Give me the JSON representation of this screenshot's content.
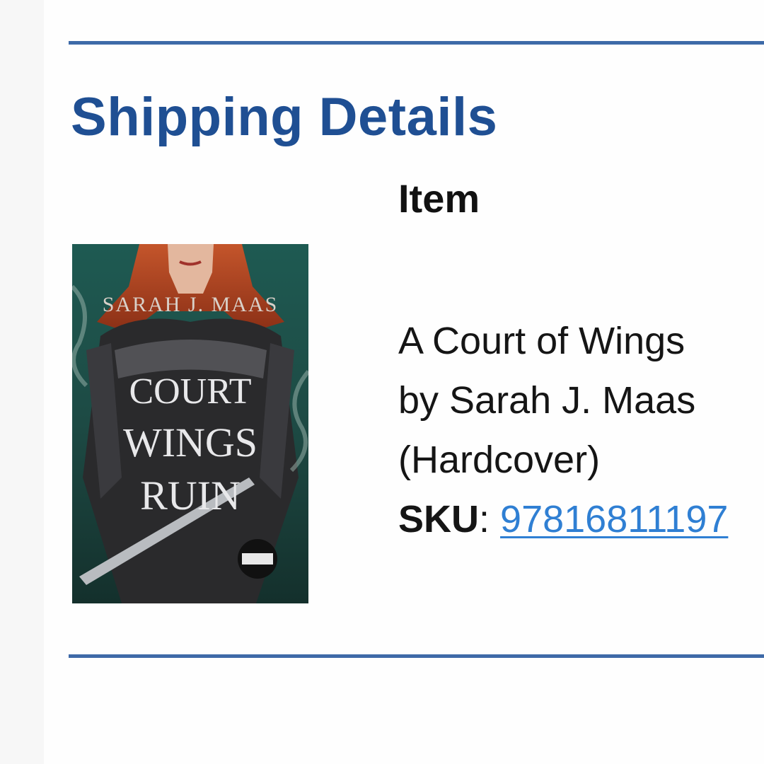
{
  "section": {
    "title": "Shipping Details"
  },
  "table": {
    "item_header": "Item"
  },
  "item": {
    "title_line": "A Court of Wings",
    "author_line": "by Sarah J. Maas",
    "format_line": "(Hardcover)",
    "sku_label": "SKU",
    "sku_separator": ":",
    "sku_value": "97816811197",
    "cover": {
      "author_text": "SARAH J. MAAS",
      "title_lines": [
        "COURT",
        "WINGS",
        "RUIN"
      ]
    }
  },
  "colors": {
    "heading": "#1f4f93",
    "rule": "#3e6aa8",
    "link": "#2f7fd3"
  }
}
